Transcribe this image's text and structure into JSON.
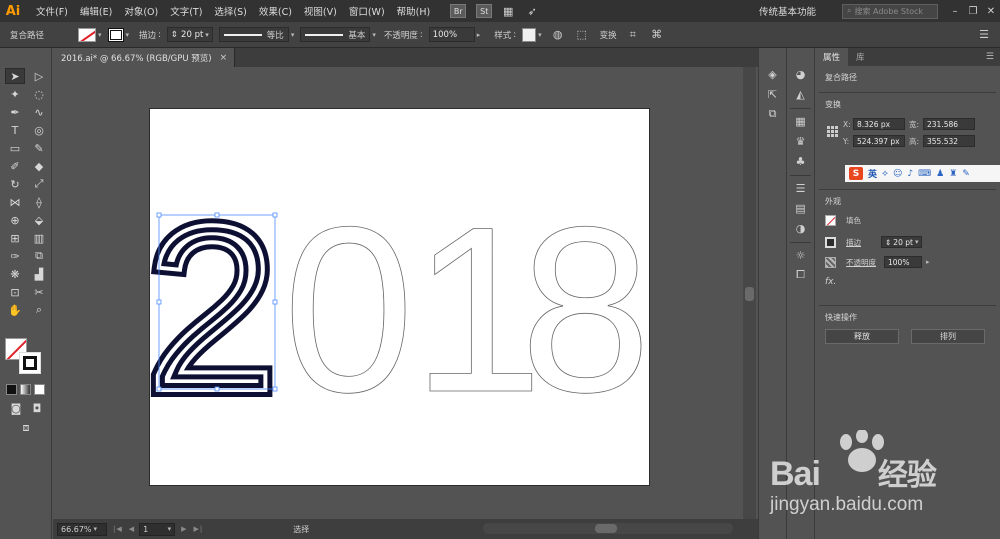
{
  "app": {
    "logo": "Ai"
  },
  "menu": {
    "items": [
      "文件(F)",
      "编辑(E)",
      "对象(O)",
      "文字(T)",
      "选择(S)",
      "效果(C)",
      "视图(V)",
      "窗口(W)",
      "帮助(H)"
    ],
    "apps": [
      "Br",
      "St"
    ],
    "workspace": "传统基本功能",
    "stock_search_placeholder": "搜索 Adobe Stock",
    "window_controls": [
      "–",
      "❐",
      "✕"
    ]
  },
  "control": {
    "selection_type": "复合路径",
    "stroke_label": "描边",
    "stroke_weight": "20 pt",
    "profile_label": "等比",
    "brush_label": "基本",
    "opacity_label": "不透明度",
    "opacity_value": "100%",
    "style_label": "样式",
    "transform_label": "变换"
  },
  "document": {
    "tab_title": "2016.ai* @ 66.67% (RGB/GPU 预览)",
    "close": "×"
  },
  "artwork": {
    "digits": [
      "2",
      "0",
      "1",
      "8"
    ],
    "selected_digit": "2"
  },
  "status": {
    "zoom": "66.67%",
    "artboard_number": "1",
    "current_tool": "选择",
    "nav_first": "|◀",
    "nav_prev": "◀",
    "nav_next": "▶",
    "nav_last": "▶|"
  },
  "properties": {
    "tabs": [
      "属性",
      "库"
    ],
    "object_type": "复合路径",
    "transform": {
      "title": "变换",
      "x_label": "X:",
      "x": "8.326 px",
      "y_label": "Y:",
      "y": "524.397 px",
      "w_label": "宽:",
      "w": "231.586",
      "h_label": "高:",
      "h": "355.532"
    },
    "appearance": {
      "title": "外观",
      "fill_label": "填色",
      "stroke_label": "描边",
      "stroke_weight": "20 pt",
      "opacity_label": "不透明度",
      "opacity_value": "100%",
      "fx_label": "fx."
    },
    "quick_actions": {
      "title": "快速操作",
      "release": "释放",
      "arrange": "排列"
    }
  },
  "ime": {
    "logo": "S",
    "mode": "英"
  },
  "watermark": {
    "brand": "Bai",
    "brand_suffix": "经验",
    "url": "jingyan.baidu.com"
  }
}
